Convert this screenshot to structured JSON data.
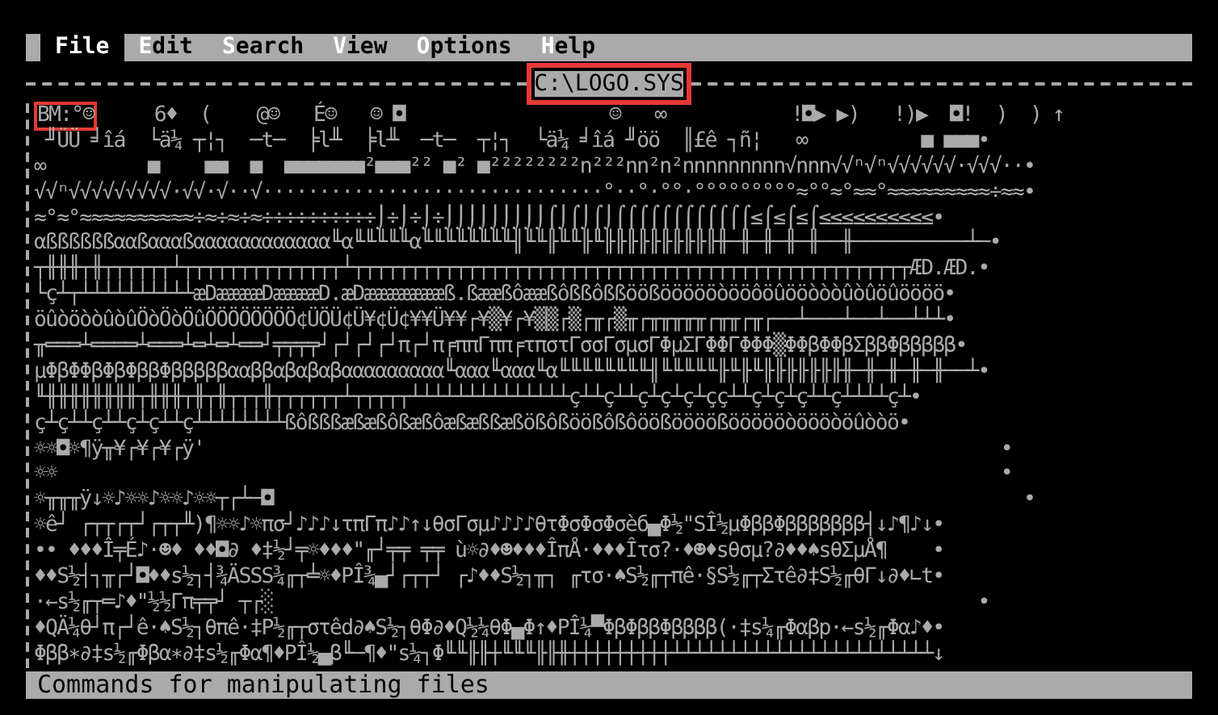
{
  "menu": [
    {
      "key": "F",
      "rest": "ile",
      "selected": true
    },
    {
      "key": "E",
      "rest": "dit",
      "selected": false
    },
    {
      "key": "S",
      "rest": "earch",
      "selected": false
    },
    {
      "key": "V",
      "rest": "iew",
      "selected": false
    },
    {
      "key": "O",
      "rest": "ptions",
      "selected": false
    },
    {
      "key": "H",
      "rest": "elp",
      "selected": false
    }
  ],
  "window": {
    "title": "C:\\LOGO.SYS",
    "title_marked": true
  },
  "lines": [
    {
      "marked": "BM:°☺",
      "text": "     6♦  (    @☺   É☺   ☺ ◘                  ☺   ∞           !◘▶ ▶)   !)▶  ◘!  )  ) ↑"
    },
    {
      "text": " ╜ÜÜ ╛îá  └ä¼ ┬¦┐  ─t─  ╞l╨  ╞l╨  ─t─  ┬¦┐  └ä¼ ╛îá ╜öö  ║£ê ┐ñ¦   ∞          ■ ■■■•"
    },
    {
      "text": "∞         ■    ■■  ■  ■■■■■■■²■■■²² ■² ■²²²²²²²²n²²²nn²n²nnnnnnnnn√nnn√√ⁿ√ⁿ√√√√√√·√√√··•"
    },
    {
      "text": "√√ⁿ√√√√√√√√√·√√·√··√······························°··°·°°·°°°°°°°°°≈°°≈°≈≈°≈≈≈≈≈≈≈≈≈÷≈≈•"
    },
    {
      "text": "≈°≈°≈≈≈≈≈≈≈≈≈≈÷≈÷≈÷≈÷÷÷÷÷÷÷÷÷÷⌡÷⌡÷⌡÷⌡⌡⌡⌡⌡⌡⌡⌡⌡⌠⌡⌠⌡⌠⌡⌠⌠⌠⌠⌠⌠⌠⌠⌠⌠⌠⌠≤⌠≤⌠≤⌠≤≤≤≤≤≤≤≤≤≤•"
    },
    {
      "text": "αßßßßßßααßαααßαααααααααααα╙α╙╙╙╙╙α╙╙╙╙╙╙╙╙╢╙╙╟╙╙╟╙╟╟╟╟╟╟╟╟╟╟╫─╫─╫─╫─╫──╫──────────┴─•"
    },
    {
      "text": "┬╫╫╫┬╫┬┬┬┬┬┬┴┬┬┬┬┬┬┬┬┬┬┬┬┬┬┴┬┬┬┬┬┬┬┬┬┬┬┬┬┬┬┬┬┬┬┬┬┬┬┬┬┬┬┬┬┬┬┬┬┬┬┬┬┬┬┬┬┬┬┬┬┬┬┬┬ÆD.ÆD.•"
    },
    {
      "text": "└ç┴┬┴┴┴┴┴┴┴┴┴┴æDææææDææææD.æDæææææææß.ßææßôææßôßßôßßöößöööööòööôöûööòòòûòûöûöööö•"
    },
    {
      "text": "öûòöòòûòûÖòÖòÖûÖÖÖÖÖÖÖÖ¢ÜÖÜ¢Ü¥¢Ü¢¥¥Ü¥¥┌¥▒¥┌¥▒▒┌▒┌╥┌▒╥┌╥╥╥╥╥┌╥╥┌╥┌──┴───┴──┴──┴┴┴•"
    },
    {
      "text": "╥═══┴════┴═══┴═┴═┴══┘╤╤╤╤┘┌┘┌┘┌┘π┌┘π╒ππΓππ╒τπστΓσσΓσμσΓΦμΣΓΦΦΓΦΦΦ▒ΦΦβΦΦβΣββΦβββββ•"
    },
    {
      "text": "μΦβΦΦβΦβΦββΦβββββααββαβαβαβααααααααα╙ααα╙ααα╙α╙╙╙╙╙╙╙╙╢╙╙╙╙╙╟╙╟╙╟╟╟╟╟╟╟╫─╫─╫─╫─╫──┴•"
    },
    {
      "text": "╙╫╫╫╫╫╫╫╫┬╫╫╫┬╫┬╫┬┬┬╫┬┬┬┬┬┬┴┬┬┬┬┬┴┴┴┴┴┴┴┴┴┴┴┴┴┴ç┴┴ç┴┴ç┴ç┴ç┴çç┴┴ç┴ç┴ç┴┴ç┴┴┴┴ç┴•"
    },
    {
      "text": "ç┴ç┴┴ç┴┴ç┴ç┴┴ç┴┴┴┴┴┴┴┴ßôßßßæßæßôßæßôæßæßßæßößôßöößôßôöößöööößöööööòöööòöûòòö•"
    },
    {
      "text": "☼☼◘☼¶ÿ╥¥┌¥┌¥┌ÿ'                                                                      •"
    },
    {
      "text": "☼☼                                                                                   •"
    },
    {
      "text": "☼╥╥╥ÿ↓☼♪☼☼♪☼☼♪☼☼┬┌┴─◘                                                                  •"
    },
    {
      "text": "☼ê┘ ┌┬┬┌┬┘┌┬┬╨)¶☼☼♪☼πσ┘♪♪♪↓τπΓπ♪♪↑↓θσΓσμ♪♪♪♪θτΦσΦσΦσèб▄Φ½\"SÎ½μΦββΦβββββββ┤↓♪¶♪↓•"
    },
    {
      "text": "•• ♦♦♦Î╤É♪·☻♦ ♦♦◘∂ ♦‡½┘╤☼♦♦♦\"╓┘╤╤ ╤╤ ù☼∂♦☻♦♦♦ÎπÅ·♦♦♦Îτσ?·♦☻♦sθσμ?∂♦♦♠sθΣμÅ¶    •"
    },
    {
      "text": "♦♦S½┤┐╥┌┘◘♦♦s½┐┤¾ÄSSS¾╓┬╧☼♦PÎ¾▄┘┌┬┬┘ ┌♪♦♦S½┐╥┐ ╓τσ·♠S½╓┬πê·§S½╓┬Στê∂‡S½╓θΓ↓∂♦∟t•"
    },
    {
      "text": "·←s½╓┬═♪♦\"½½Γπ╤╤┘ ┬┌░                                                              •"
    },
    {
      "text": "♦QÄ¼θ┘π┌┘ê·♠S½┐θπê·‡P½╓┬στêd∂♠S½┐θΦ∂♦Q½¼θΦ▄Φ↑♦PÎ¼▀ΦβΦββΦββββ(·‡s¼╓Φαβp·←s½╓Φα♪♦•"
    },
    {
      "text": "Φββ∗∂‡s½╓Φβα∗∂‡s½╓Φα¶♦PÎ½▄β╙─¶♦\"s¼┐Φ╙╙╟╟┼╙╙╙╟╟╫┼┼┼┼┼┼┼┼┼┴┴┴┴┴┴┴┴┴┴┴┴┴┴┴┴┴┴┴┴┴┴┴↓"
    }
  ],
  "status_bar": "Commands for manipulating files"
}
